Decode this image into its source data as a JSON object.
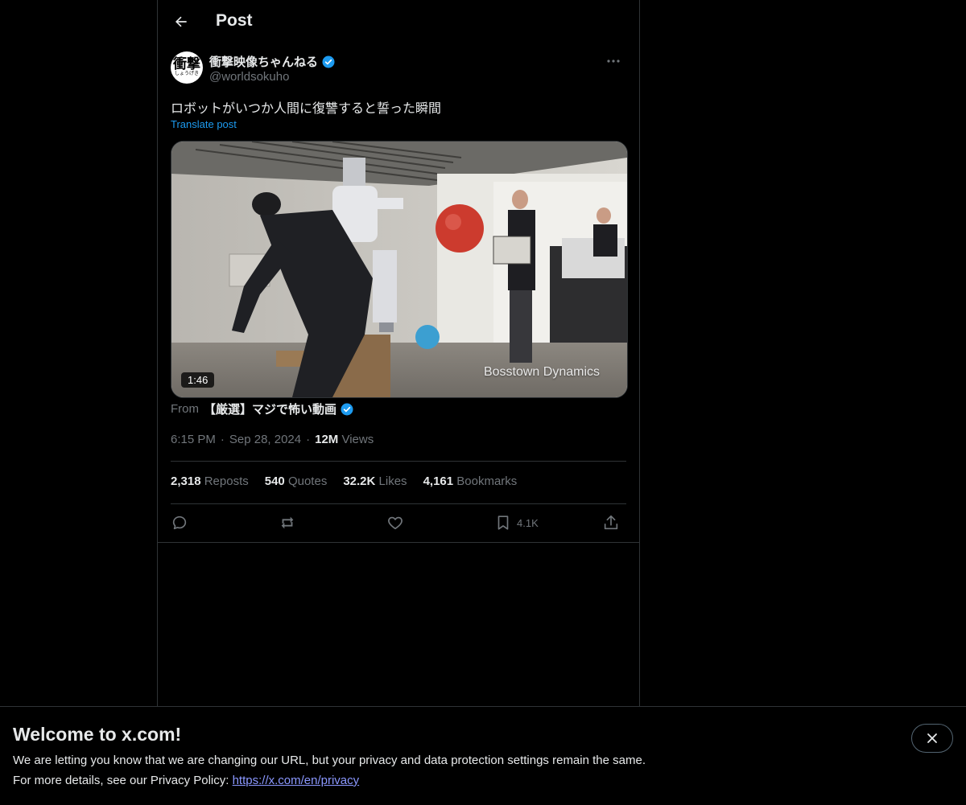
{
  "header": {
    "title": "Post"
  },
  "author": {
    "name": "衝撃映像ちゃんねる",
    "handle": "@worldsokuho",
    "avatar_text": "衝撃",
    "avatar_subtext": "しょうげき",
    "verified_color": "#1d9bf0"
  },
  "post": {
    "text": "ロボットがいつか人間に復讐すると誓った瞬間",
    "translate_label": "Translate post",
    "video_duration": "1:46",
    "video_watermark": "Bosstown Dynamics"
  },
  "source": {
    "prefix": "From",
    "name": "【厳選】マジで怖い動画"
  },
  "meta": {
    "time": "6:15 PM",
    "separator": "·",
    "date": "Sep 28, 2024",
    "views_count": "12M",
    "views_label": "Views"
  },
  "stats": {
    "reposts": {
      "num": "2,318",
      "label": "Reposts"
    },
    "quotes": {
      "num": "540",
      "label": "Quotes"
    },
    "likes": {
      "num": "32.2K",
      "label": "Likes"
    },
    "bookmarks": {
      "num": "4,161",
      "label": "Bookmarks"
    }
  },
  "actions": {
    "bookmark_count": "4.1K"
  },
  "banner": {
    "title": "Welcome to x.com!",
    "line1": "We are letting you know that we are changing our URL, but your privacy and data protection settings remain the same.",
    "line2_prefix": "For more details, see our Privacy Policy: ",
    "link": "https://x.com/en/privacy"
  },
  "colors": {
    "background": "#000000",
    "text": "#e7e9ea",
    "secondary_text": "#71767b",
    "accent": "#1d9bf0",
    "border": "#2f3336"
  }
}
